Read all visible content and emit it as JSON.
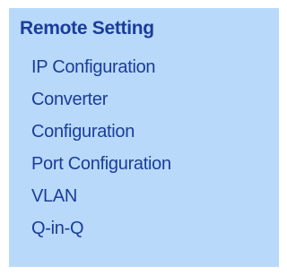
{
  "menu": {
    "heading": "Remote Setting",
    "items": [
      {
        "label": "IP Configuration"
      },
      {
        "label": "Converter"
      },
      {
        "label": "Configuration"
      },
      {
        "label": "Port Configuration"
      },
      {
        "label": "VLAN"
      },
      {
        "label": "Q-in-Q"
      }
    ]
  },
  "colors": {
    "panel_background": "#b9d9fb",
    "text": "#1a3d9a"
  }
}
